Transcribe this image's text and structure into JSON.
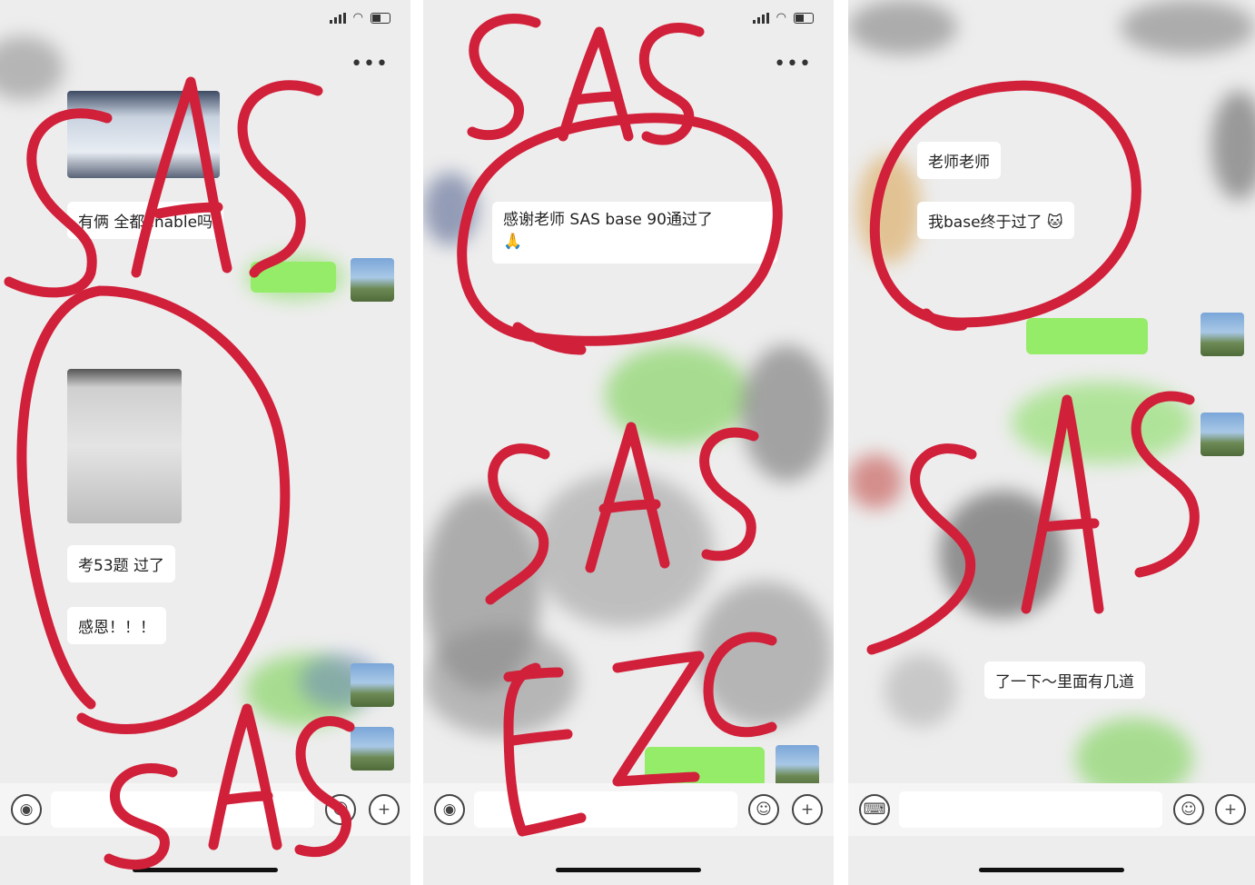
{
  "screens": [
    {
      "messages": [
        "有俩 全都enable吗",
        "考53题 过了",
        "感恩！！！"
      ]
    },
    {
      "messages": [
        "感谢老师 SAS base 90通过了",
        "🙏"
      ]
    },
    {
      "messages": [
        "老师老师",
        "我base终于过了 🐱",
        "了一下～里面有几道"
      ]
    }
  ],
  "icons": {
    "voice": "◉",
    "emoji": "☺",
    "plus": "+",
    "keyboard": "⌨",
    "more": "•••"
  },
  "colors": {
    "chat_bg": "#ededed",
    "bubble_self": "#95ec69",
    "bubble_other": "#ffffff",
    "annotation_ink": "#d1203a"
  }
}
